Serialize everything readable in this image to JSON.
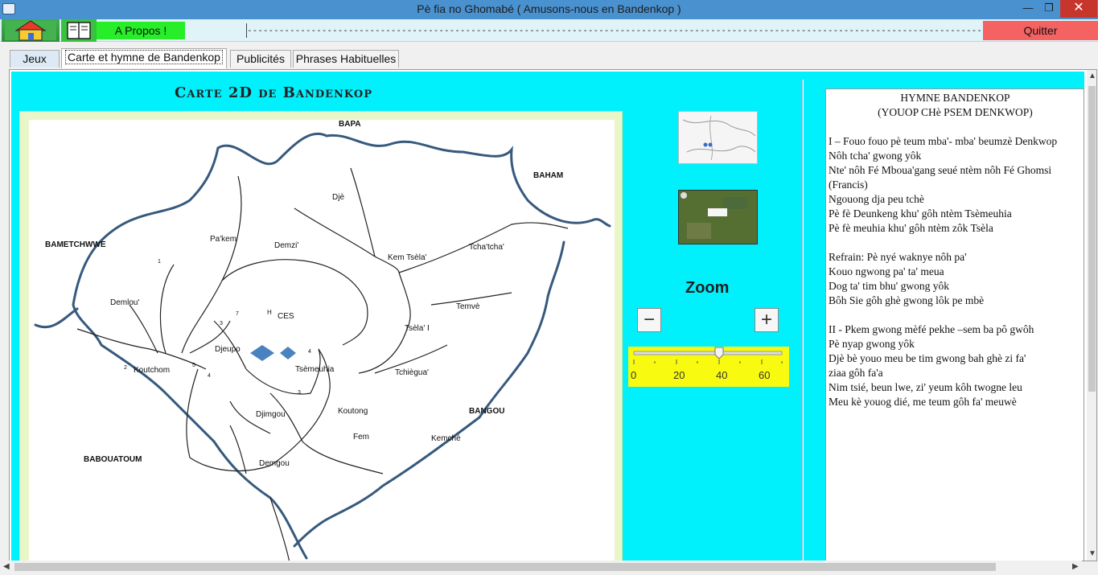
{
  "window": {
    "title": "Pè fia no Ghomabé ( Amusons-nous en Bandenkop )",
    "min_glyph": "—",
    "max_glyph": "❐",
    "close_glyph": "✕"
  },
  "toolbar": {
    "about_label": "A Propos !",
    "arrows_text": "------------------------------------------------------------------------------------------------------------------------------------------------------------>>>>>>>>>>>>>>>",
    "quit_label": "Quitter"
  },
  "tabs": [
    {
      "label": "Jeux"
    },
    {
      "label": "Carte et hymne de Bandenkop"
    },
    {
      "label": "Publicités"
    },
    {
      "label": "Phrases Habituelles"
    }
  ],
  "map": {
    "title": "Carte 2D de Bandenkop",
    "places": {
      "bapa": "BAPA",
      "baham": "BAHAM",
      "bametchwwe": "BAMETCHWWE",
      "dje": "Djè",
      "pakem": "Pa'kem",
      "demzi": "Demzi'",
      "kem_tsela": "Kem Tsèla'",
      "tchatcha": "Tcha'tcha'",
      "ces": "CES",
      "h": "H",
      "demlou": "Demlou'",
      "temve": "Temvè",
      "tsela_i": "Tsèla' I",
      "djeupo": "Djeupo",
      "koutchom": "Koutchom",
      "tsemeuhia": "Tsèmeuhia",
      "tchiegua": "Tchiègua'",
      "djimgou": "Djimgou",
      "koutong": "Koutong",
      "bangou": "BANGOU",
      "fem": "Fem",
      "kemche": "Kemchè",
      "babouatoum": "BABOUATOUM",
      "demgou": "Demgou",
      "n1": "1",
      "n2": "2",
      "n3": "3",
      "n3b": "3",
      "n4": "4",
      "n4b": "4",
      "n5": "5",
      "n7": "7"
    }
  },
  "zoom": {
    "label": "Zoom",
    "minus": "−",
    "plus": "+",
    "value": 40,
    "ticks": [
      "0",
      "20",
      "40",
      "60"
    ]
  },
  "hymn": {
    "title1": "HYMNE BANDENKOP",
    "title2": "(YOUOP CHè PSEM DENKWOP)",
    "lines": [
      "I – Fouo fouo pè teum mba'- mba' beumzè Denkwop",
      "Nôh tcha' gwong yôk",
      "Nte' nôh Fé Mboua'gang seué ntèm nôh Fé Ghomsi",
      "(Francis)",
      "Ngouong dja peu tchè",
      "Pè fè Deunkeng khu' gôh ntèm Tsèmeuhia",
      "Pè fè meuhia khu' gôh ntèm zôk Tsèla",
      "",
      "Refrain: Pè nyé waknye nôh pa'",
      "Kouo ngwong pa' ta' meua",
      "Dog ta' tim bhu' gwong yôk",
      "Bôh Sie gôh ghè gwong lôk pe mbè",
      "",
      "II - Pkem gwong mèfé pekhe –sem ba pô gwôh",
      "Pè nyap gwong yôk",
      "Djè bè youo meu be tim gwong bah ghè zi fa'",
      "ziaa gôh fa'a",
      "Nim tsié, beun lwe, zi' yeum kôh twogne leu",
      "Meu kè youog dié, me teum gôh fa' meuwè"
    ]
  }
}
